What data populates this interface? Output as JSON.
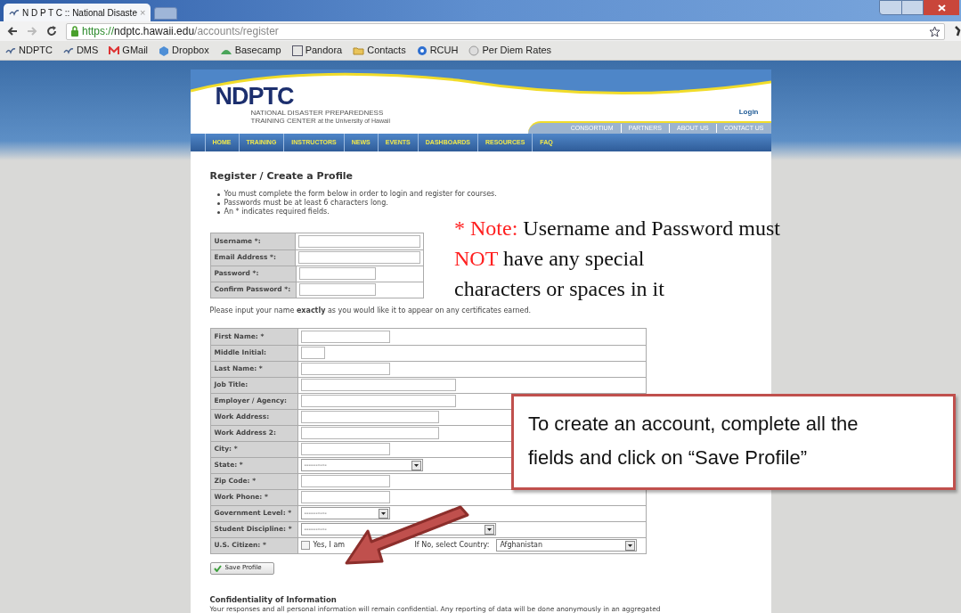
{
  "browser": {
    "tab": {
      "title": "N D P T C :: National Disaste",
      "close": "×"
    },
    "url": {
      "scheme": "https://",
      "host": "ndptc.hawaii.edu",
      "path": "/accounts/register"
    },
    "bookmarks": [
      {
        "label": "NDPTC",
        "kind": "site"
      },
      {
        "label": "DMS",
        "kind": "site"
      },
      {
        "label": "GMail",
        "kind": "mail"
      },
      {
        "label": "Dropbox",
        "kind": "box"
      },
      {
        "label": "Basecamp",
        "kind": "hill"
      },
      {
        "label": "Pandora",
        "kind": "letter"
      },
      {
        "label": "Contacts",
        "kind": "folder"
      },
      {
        "label": "RCUH",
        "kind": "ball"
      },
      {
        "label": "Per Diem Rates",
        "kind": "globe"
      }
    ]
  },
  "site": {
    "logo": {
      "mark": "NDPTC",
      "line_1": "NATIONAL DISASTER PREPAREDNESS",
      "line_2": "TRAINING CENTER",
      "line_2_suffix": "at the University of Hawaii"
    },
    "login": "Login",
    "top_links": [
      "CONSORTIUM",
      "PARTNERS",
      "ABOUT US",
      "CONTACT US"
    ],
    "nav": [
      "HOME",
      "TRAINING",
      "INSTRUCTORS",
      "NEWS",
      "EVENTS",
      "DASHBOARDS",
      "RESOURCES",
      "FAQ"
    ]
  },
  "form": {
    "title": "Register / Create a Profile",
    "bullets": [
      "You must complete the form below in order to login and register for courses.",
      "Passwords must be at least 6 characters long.",
      "An * indicates required fields."
    ],
    "account_fields": [
      {
        "label": "Username *:"
      },
      {
        "label": "Email Address *:"
      },
      {
        "label": "Password *:"
      },
      {
        "label": "Confirm Password *:"
      }
    ],
    "name_hint": "Please input your name **exactly** as you would like it to appear on any certificates earned.",
    "profile_fields": [
      {
        "label": "First Name: *",
        "kind": "text"
      },
      {
        "label": "Middle Initial:",
        "kind": "text"
      },
      {
        "label": "Last Name: *",
        "kind": "text"
      },
      {
        "label": "Job Title:",
        "kind": "text"
      },
      {
        "label": "Employer / Agency:",
        "kind": "text"
      },
      {
        "label": "Work Address:",
        "kind": "text"
      },
      {
        "label": "Work Address 2:",
        "kind": "text"
      },
      {
        "label": "City: *",
        "kind": "text"
      },
      {
        "label": "State: *",
        "kind": "select",
        "value": "----------"
      },
      {
        "label": "Zip Code: *",
        "kind": "text"
      },
      {
        "label": "Work Phone: *",
        "kind": "text"
      },
      {
        "label": "Government Level: *",
        "kind": "select",
        "value": "----------"
      },
      {
        "label": "Student Discipline: *",
        "kind": "select",
        "value": "----------"
      },
      {
        "label": "U.S. Citizen: *",
        "kind": "citizen",
        "checked": false,
        "checkbox_label": "Yes, I am",
        "country_label": "If No, select Country:",
        "country": "Afghanistan"
      }
    ],
    "save_button": "Save Profile",
    "confidentiality_title": "Confidentiality of Information",
    "confidentiality_text": "Your responses and all personal information will remain confidential. Any reporting of data will be done anonymously in an aggregated"
  },
  "annotations": {
    "note": [
      [
        {
          "text": "* Note:",
          "emphasis": true
        },
        {
          "text": " Username and Password must",
          "emphasis": false
        }
      ],
      [
        {
          "text": "NOT",
          "emphasis": true
        },
        {
          "text": " have any special",
          "emphasis": false
        }
      ],
      [
        {
          "text": "characters or spaces in it",
          "emphasis": false
        }
      ]
    ],
    "callout": "To create an account, complete all the fields and click on “Save Profile”"
  }
}
